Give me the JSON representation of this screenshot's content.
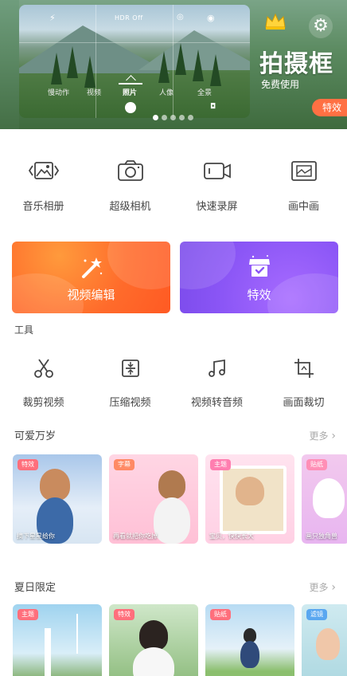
{
  "banner": {
    "camera_hdr_label": "HDR Off",
    "camera_modes": [
      "慢动作",
      "视频",
      "照片",
      "人像",
      "全景"
    ],
    "active_mode": "照片",
    "promo_title": "拍摄框",
    "promo_subtitle": "免费使用",
    "promo_badge": "特效",
    "pager_dots": 5,
    "pager_active": 0
  },
  "quick_actions": [
    {
      "label": "音乐相册",
      "icon": "photo-album-icon"
    },
    {
      "label": "超级相机",
      "icon": "camera-icon"
    },
    {
      "label": "快速录屏",
      "icon": "screen-record-icon"
    },
    {
      "label": "画中画",
      "icon": "picture-in-picture-icon"
    }
  ],
  "feature_cards": [
    {
      "label": "视频编辑",
      "icon": "magic-wand-icon",
      "color": "#ff6b2b"
    },
    {
      "label": "特效",
      "icon": "store-icon",
      "color": "#8b56f6"
    }
  ],
  "tools": {
    "title": "工具",
    "items": [
      {
        "label": "裁剪视频",
        "icon": "scissors-icon"
      },
      {
        "label": "压缩视频",
        "icon": "compress-icon"
      },
      {
        "label": "视频转音频",
        "icon": "music-note-icon"
      },
      {
        "label": "画面裁切",
        "icon": "crop-icon"
      }
    ]
  },
  "section_cute": {
    "title": "可爱万岁",
    "more": "更多",
    "items": [
      {
        "tag": "特效",
        "caption": "摘下星星给你"
      },
      {
        "tag": "字幕",
        "caption": "再看就把你吃掉"
      },
      {
        "tag": "主题",
        "caption": "宝贝，快快长大"
      },
      {
        "tag": "贴纸",
        "caption": "画只独角兽"
      }
    ]
  },
  "section_summer": {
    "title": "夏日限定",
    "more": "更多",
    "items": [
      {
        "tag": "主题"
      },
      {
        "tag": "特效"
      },
      {
        "tag": "贴纸"
      },
      {
        "tag": "滤镜"
      }
    ]
  }
}
